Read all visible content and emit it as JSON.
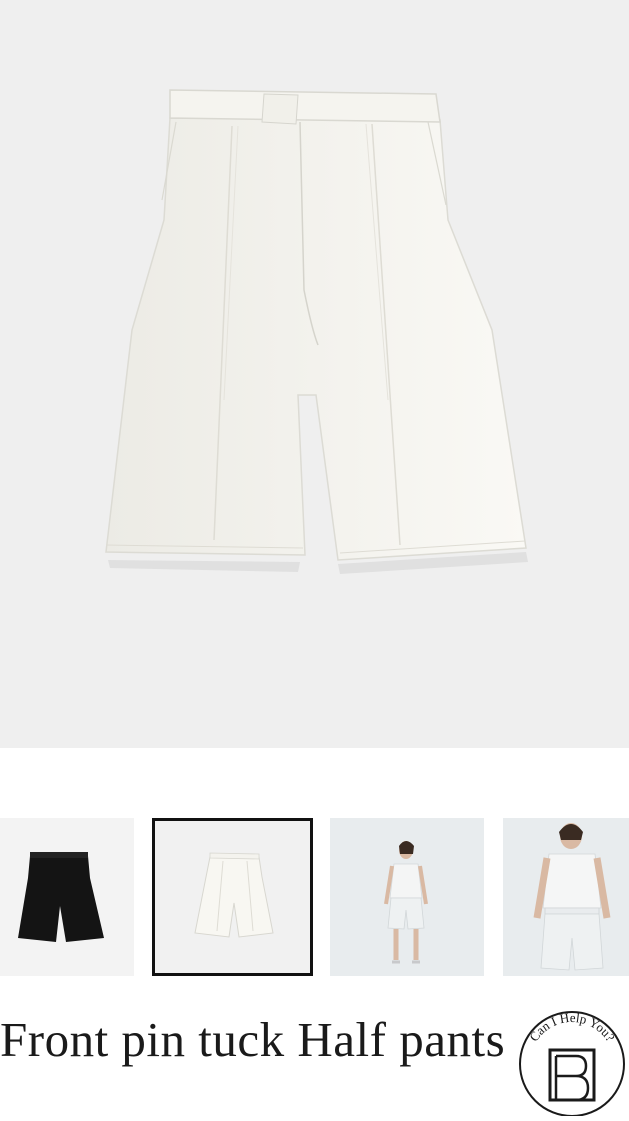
{
  "product": {
    "title": "Front pin tuck Half pants",
    "main_image": "white-half-pants-photo",
    "thumbnails": [
      {
        "name": "black-half-pants-thumbnail",
        "selected": false
      },
      {
        "name": "white-half-pants-thumbnail",
        "selected": true
      },
      {
        "name": "model-full-length-thumbnail",
        "selected": false
      },
      {
        "name": "model-closeup-thumbnail",
        "selected": false
      }
    ]
  },
  "help_badge": {
    "text": "Can I Help You?",
    "icon": "brand-logo-icon"
  },
  "colors": {
    "hero_bg": "#efefef",
    "garment_white": "#f7f6f1",
    "garment_black": "#141414",
    "selected_border": "#111111",
    "title_text": "#1a1a1a"
  }
}
